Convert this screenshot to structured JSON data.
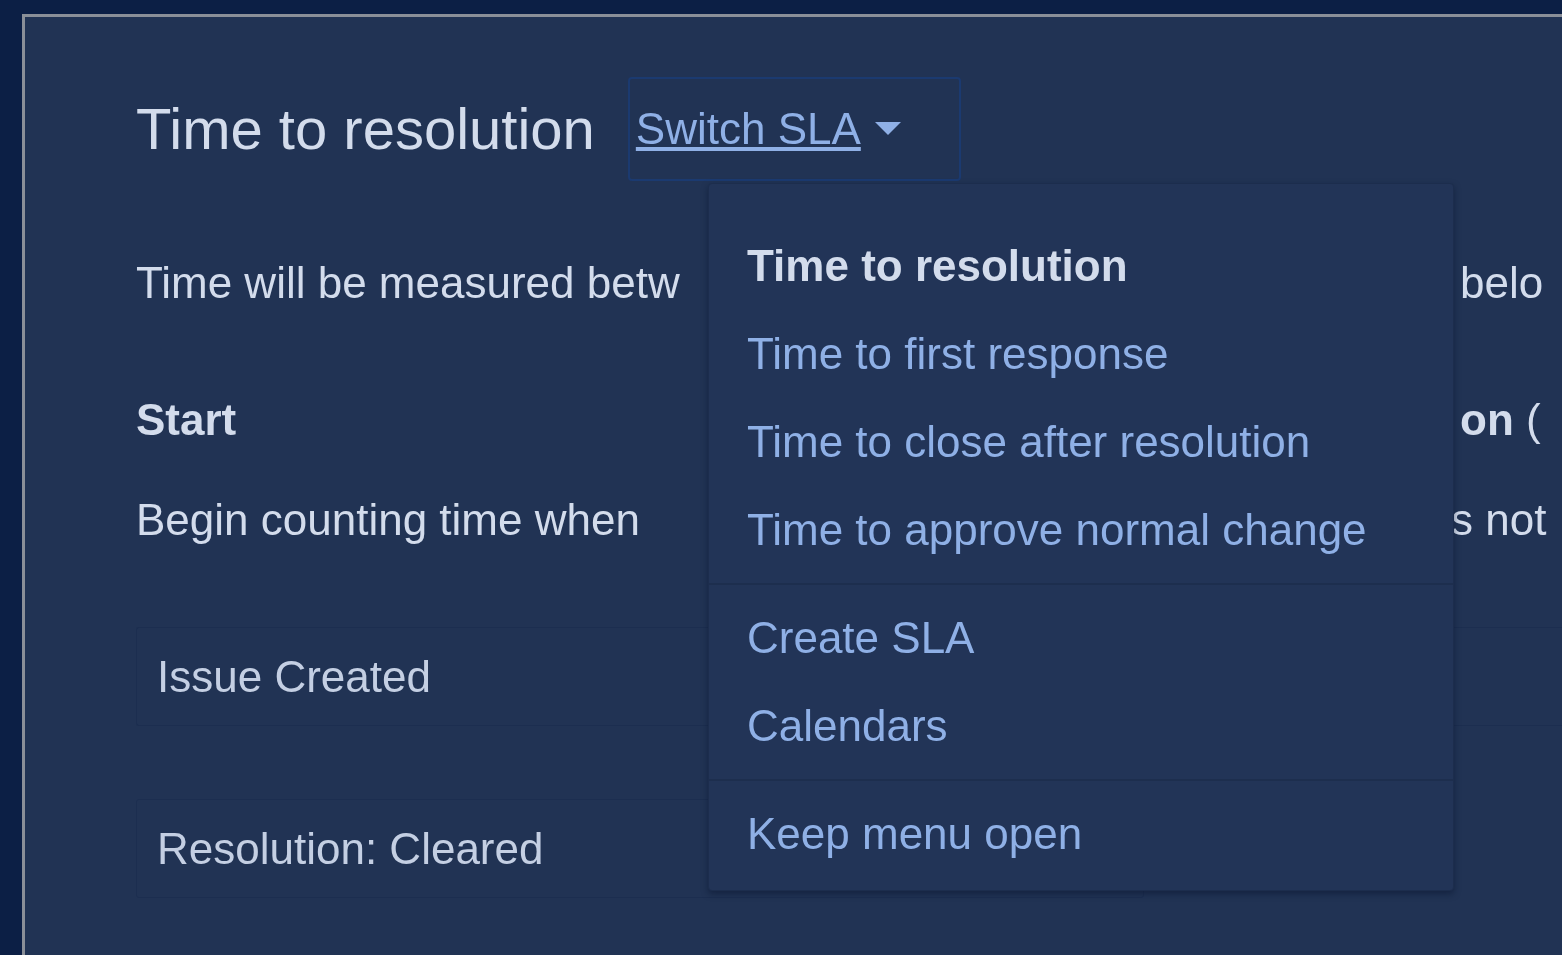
{
  "title": "Time to resolution",
  "switch_button": {
    "label": "Switch SLA",
    "expanded": true
  },
  "description": {
    "text_start": "Time will be measured betw",
    "text_end": "belo"
  },
  "start": {
    "heading": "Start",
    "heading_end": "**on** (",
    "text": "Begin counting time when",
    "text_end": "s not"
  },
  "fields": [
    {
      "value": "Issue Created"
    },
    {
      "value": "Resolution: Cleared"
    }
  ],
  "menu": {
    "sections": [
      {
        "items": [
          {
            "label": "Time to resolution",
            "selected": true
          },
          {
            "label": "Time to first response",
            "selected": false
          },
          {
            "label": "Time to close after resolution",
            "selected": false
          },
          {
            "label": "Time to approve normal change",
            "selected": false
          }
        ]
      },
      {
        "items": [
          {
            "label": "Create SLA"
          },
          {
            "label": "Calendars"
          }
        ]
      },
      {
        "items": [
          {
            "label": "Keep menu open"
          }
        ]
      }
    ]
  }
}
